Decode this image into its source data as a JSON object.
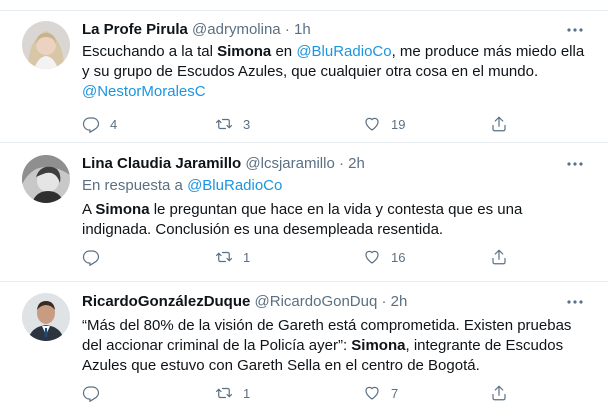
{
  "tweets": [
    {
      "name": "La Profe Pirula",
      "handle": "@adrymolina",
      "dot": "·",
      "time": "1h",
      "avatar_icon": "woman-blonde-avatar",
      "text_parts": [
        {
          "t": "Escuchando a la tal ",
          "s": "plain"
        },
        {
          "t": "Simona",
          "s": "bold"
        },
        {
          "t": " en ",
          "s": "plain"
        },
        {
          "t": "@BluRadioCo",
          "s": "link"
        },
        {
          "t": ", me produce más miedo ella y su grupo de Escudos Azules, que cualquier  otra cosa en el mundo. ",
          "s": "plain"
        },
        {
          "t": "@NestorMoralesC",
          "s": "link"
        }
      ],
      "replies": "4",
      "retweets": "3",
      "likes": "19"
    },
    {
      "name": "Lina Claudia Jaramillo",
      "handle": "@lcsjaramillo",
      "dot": "·",
      "time": "2h",
      "avatar_icon": "grayscale-woman-avatar",
      "reply_prefix": "En respuesta a ",
      "reply_to": "@BluRadioCo",
      "text_parts": [
        {
          "t": "A ",
          "s": "plain"
        },
        {
          "t": "Simona",
          "s": "bold"
        },
        {
          "t": " le preguntan que hace en la vida y contesta que es una indignada. Conclusión es una desempleada resentida.",
          "s": "plain"
        }
      ],
      "replies": "",
      "retweets": "1",
      "likes": "16"
    },
    {
      "name": "RicardoGonzálezDuque",
      "handle": "@RicardoGonDuq",
      "dot": "·",
      "time": "2h",
      "avatar_icon": "man-suit-avatar",
      "text_parts": [
        {
          "t": "“Más del 80% de la visión de Gareth está comprometida. Existen pruebas del accionar criminal de la Policía ayer”: ",
          "s": "plain"
        },
        {
          "t": "Simona",
          "s": "bold"
        },
        {
          "t": ", integrante de Escudos Azules que estuvo con Gareth Sella en el centro de Bogotá.",
          "s": "plain"
        }
      ],
      "replies": "",
      "retweets": "1",
      "likes": "7"
    }
  ],
  "colors": {
    "text": "#0f1419",
    "secondary": "#5b7083",
    "link": "#1b95e0",
    "border": "#e6ecf0"
  }
}
